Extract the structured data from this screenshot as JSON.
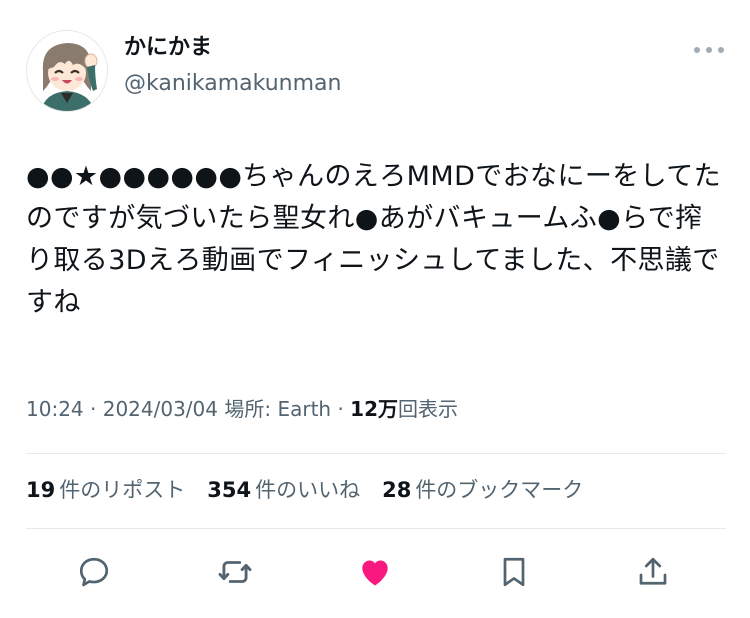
{
  "author": {
    "display_name": "かにかま",
    "handle": "@kanikamakunman"
  },
  "more_icon": "more-horizontal-icon",
  "tweet": {
    "text": "●●★●●●●●●ちゃんのえろMMDでおなにーをしてたのですが気づいたら聖女れ●あがバキュームふ●らで搾り取る3Dえろ動画でフィニッシュしてました、不思議ですね"
  },
  "meta": {
    "time": "10:24",
    "separator": "·",
    "date": "2024/03/04",
    "location": "場所: Earth",
    "views_value": "12万",
    "views_label": "回表示"
  },
  "stats": {
    "reposts_count": "19",
    "reposts_label": "件のリポスト",
    "likes_count": "354",
    "likes_label": "件のいいね",
    "bookmarks_count": "28",
    "bookmarks_label": "件のブックマーク"
  },
  "actions": {
    "reply_icon": "reply-bubble-icon",
    "repost_icon": "repost-arrows-icon",
    "like_icon": "heart-filled-icon",
    "bookmark_icon": "bookmark-icon",
    "share_icon": "share-upload-icon",
    "like_color": "#f91880",
    "icon_color": "#536471"
  }
}
